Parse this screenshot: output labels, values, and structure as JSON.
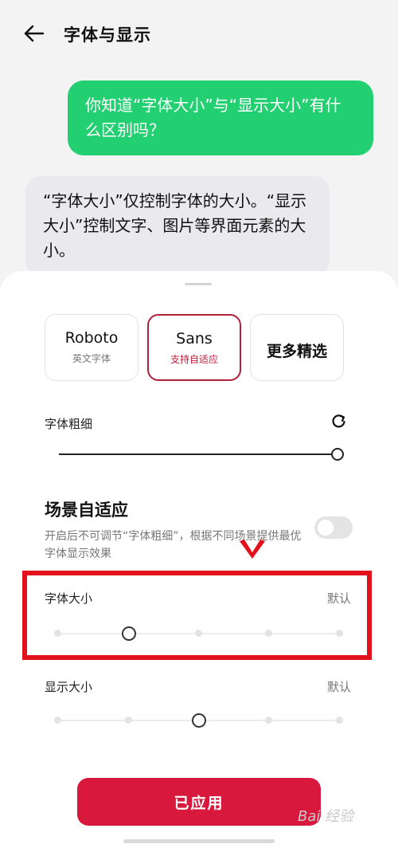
{
  "header": {
    "title": "字体与显示"
  },
  "chat": {
    "user_message": "你知道“字体大小”与“显示大小”有什么区别吗？",
    "bot_message": "“字体大小”仅控制字体的大小。“显示大小”控制文字、图片等界面元素的大小。"
  },
  "fonts": {
    "options": [
      {
        "name": "Roboto",
        "sub": "英文字体",
        "selected": false
      },
      {
        "name": "Sans",
        "sub": "支持自适应",
        "selected": true
      },
      {
        "name": "更多精选",
        "sub": "",
        "selected": false
      }
    ]
  },
  "weight": {
    "label": "字体粗细",
    "value_fraction": 1.0
  },
  "adaptive": {
    "title": "场景自适应",
    "description": "开启后不可调节“字体粗细”，根据不同场景提供最优字体显示效果",
    "enabled": false
  },
  "font_size": {
    "label": "字体大小",
    "value_label": "默认",
    "steps": 5,
    "selected_step": 1
  },
  "display_size": {
    "label": "显示大小",
    "value_label": "默认",
    "steps": 5,
    "selected_step": 2
  },
  "apply_button": {
    "label": "已应用"
  },
  "watermark": {
    "text": "Bai 经验"
  },
  "colors": {
    "user_bubble": "#22cf71",
    "accent": "#d8193d",
    "highlight": "#e3111b"
  }
}
